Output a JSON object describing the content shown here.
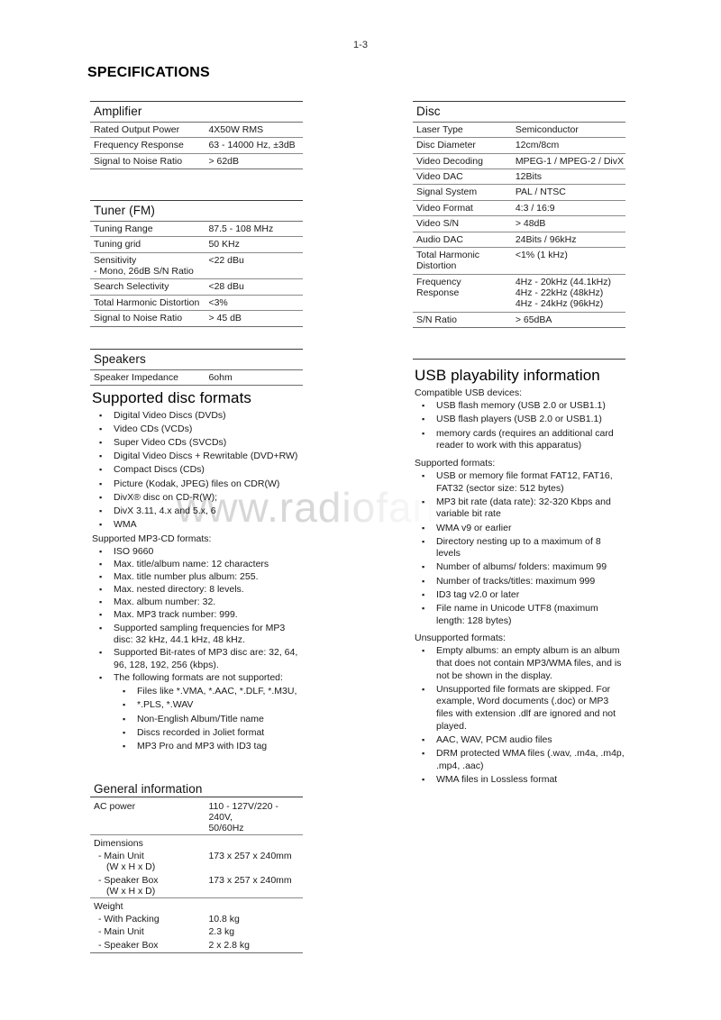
{
  "page": {
    "number": "1-3",
    "title": "SPECIFICATIONS",
    "watermark": "www.radiofans"
  },
  "left_column": {
    "amplifier": {
      "heading": "Amplifier",
      "rows": [
        {
          "key": "Rated Output Power",
          "value": "4X50W RMS"
        },
        {
          "key": "Frequency Response",
          "value": "63 - 14000 Hz, ±3dB"
        },
        {
          "key": "Signal to Noise Ratio",
          "value": "> 62dB"
        }
      ]
    },
    "tuner": {
      "heading": "Tuner (FM)",
      "rows": [
        {
          "key": "Tuning Range",
          "value": "87.5 - 108 MHz"
        },
        {
          "key": "Tuning grid",
          "value": "50 KHz"
        },
        {
          "key": "Sensitivity",
          "value": "<22 dBu"
        },
        {
          "key": "- Mono, 26dB S/N Ratio",
          "value": ""
        },
        {
          "key": "Search Selectivity",
          "value": "<28 dBu"
        },
        {
          "key": "Total Harmonic Distortion",
          "value": "<3%"
        },
        {
          "key": "Signal to Noise Ratio",
          "value": "> 45 dB"
        }
      ]
    },
    "speakers": {
      "heading": "Speakers",
      "rows": [
        {
          "key": "Speaker Impedance",
          "value": "6ohm"
        }
      ]
    },
    "supported_disc_formats": {
      "heading": "Supported disc formats",
      "items": [
        "Digital Video Discs (DVDs)",
        "Video CDs (VCDs)",
        "Super Video CDs (SVCDs)",
        "Digital Video Discs + Rewritable (DVD+RW)",
        "Compact Discs (CDs)",
        "Picture (Kodak, JPEG) files on CDR(W)",
        "DivX® disc on CD-R(W);",
        "DivX 3.11, 4.x and 5.x, 6",
        "WMA"
      ],
      "mp3_lead": "Supported MP3-CD formats:",
      "mp3_items": [
        "ISO 9660",
        "Max. title/album name: 12 characters",
        "Max. title number plus album: 255.",
        "Max. nested directory: 8 levels.",
        "Max. album number: 32.",
        "Max. MP3 track number: 999.",
        "Supported sampling frequencies for MP3 disc: 32 kHz, 44.1 kHz, 48 kHz.",
        "Supported Bit-rates of MP3 disc are: 32, 64, 96, 128, 192, 256 (kbps)."
      ],
      "not_supported_lead": "The following formats are not supported:",
      "not_supported_items": [
        "Files like *.VMA, *.AAC, *.DLF, *.M3U,",
        "*.PLS, *.WAV",
        "Non-English Album/Title name",
        "Discs recorded in Joliet format",
        "MP3 Pro and MP3 with ID3 tag"
      ]
    },
    "general_information": {
      "heading": "General information",
      "rows": [
        {
          "key": "AC power",
          "value": "110 - 127V/220 - 240V, 50/60Hz"
        },
        {
          "key": "Dimensions",
          "value": ""
        },
        {
          "key": "- Main Unit (W x H x D)",
          "value": "173 x 257 x 240mm"
        },
        {
          "key": "- Speaker Box (W x H x D)",
          "value": "173 x 257 x 240mm"
        },
        {
          "key": "Weight",
          "value": ""
        },
        {
          "key": "- With Packing",
          "value": "10.8 kg"
        },
        {
          "key": "- Main Unit",
          "value": "2.3 kg"
        },
        {
          "key": "- Speaker Box",
          "value": "2 x 2.8 kg"
        }
      ]
    }
  },
  "right_column": {
    "disc": {
      "heading": "Disc",
      "rows": [
        {
          "key": "Laser Type",
          "value": "Semiconductor"
        },
        {
          "key": "Disc Diameter",
          "value": "12cm/8cm"
        },
        {
          "key": "Video Decoding",
          "value": "MPEG-1 / MPEG-2 / DivX"
        },
        {
          "key": "Video DAC",
          "value": "12Bits"
        },
        {
          "key": "Signal System",
          "value": "PAL / NTSC"
        },
        {
          "key": "Video Format",
          "value": "4:3 / 16:9"
        },
        {
          "key": "Video S/N",
          "value": "> 48dB"
        },
        {
          "key": "Audio DAC",
          "value": "24Bits / 96kHz"
        },
        {
          "key": "Total Harmonic Distortion",
          "value": "<1% (1 kHz)"
        },
        {
          "key": "Frequency Response",
          "value": "4Hz - 20kHz (44.1kHz) 4Hz - 22kHz (48kHz) 4Hz - 24kHz (96kHz)"
        },
        {
          "key": "S/N Ratio",
          "value": "> 65dBA"
        }
      ],
      "thd_key_line1": "Total Harmonic",
      "thd_key_line2": "Distortion",
      "thd_value": "<1% (1 kHz)",
      "freq_key_line1": "Frequency",
      "freq_key_line2": "Response",
      "freq_value_line1": "4Hz - 20kHz (44.1kHz)",
      "freq_value_line2": "4Hz - 22kHz (48kHz)",
      "freq_value_line3": "4Hz - 24kHz (96kHz)"
    },
    "usb": {
      "heading": "USB playability information",
      "compatible_lead": "Compatible USB devices:",
      "compatible_items": [
        "USB flash memory (USB 2.0 or USB1.1)",
        "USB flash players (USB 2.0 or USB1.1)",
        "memory cards (requires an additional card reader to work with this apparatus)"
      ],
      "supported_lead": "Supported formats:",
      "supported_items": [
        "USB or memory file format FAT12, FAT16, FAT32 (sector size: 512 bytes)",
        "MP3 bit rate (data rate): 32-320 Kbps and variable bit rate",
        "WMA v9 or earlier",
        "Directory nesting up to a maximum of 8 levels",
        "Number of albums/ folders: maximum 99",
        "Number of tracks/titles: maximum 999",
        "ID3 tag v2.0 or later",
        "File name in Unicode UTF8 (maximum length: 128 bytes)"
      ],
      "unsupported_lead": "Unsupported formats:",
      "unsupported_items": [
        "Empty albums: an empty album is an album that does not contain MP3/WMA files, and is not be shown in the display.",
        "Unsupported file formats are skipped. For example, Word documents (.doc) or MP3 files with extension .dlf are ignored and not played.",
        "AAC, WAV, PCM audio files",
        "DRM protected WMA files (.wav, .m4a, .m4p, .mp4, .aac)",
        "WMA files in Lossless format"
      ]
    }
  },
  "glyphs": {
    "bullet": "▪"
  }
}
